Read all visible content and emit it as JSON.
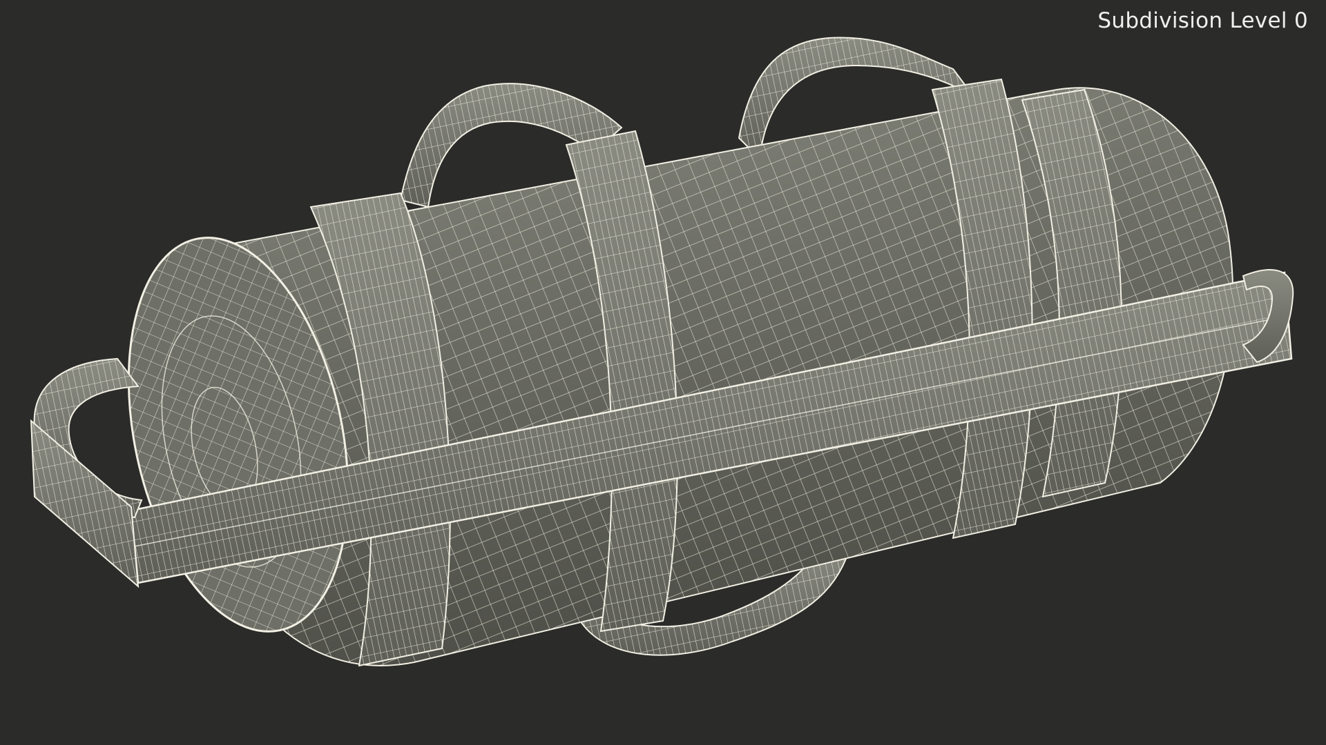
{
  "viewport": {
    "overlay_label": "Subdivision Level 0",
    "background_color": "#2b2b29",
    "model_color": "#6f7066",
    "wire_color": "#f2f0e4"
  },
  "model": {
    "name_icon": "sandbag-wireframe-icon"
  }
}
